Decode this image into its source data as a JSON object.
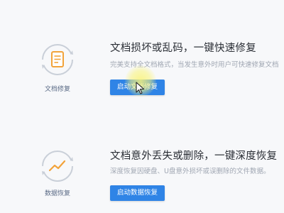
{
  "cards": [
    {
      "icon": "document-icon",
      "icon_label": "文档修复",
      "title": "文档损坏或乱码，一键快速修复",
      "description": "完美支持全文档格式，当发生意外时用户可快速修复文档",
      "button_label": "启动文档修复"
    },
    {
      "icon": "trend-line-icon",
      "icon_label": "数据恢复",
      "title": "文档意外丢失或删除，一键深度恢复",
      "description": "深度恢复因硬盘、U盘意外损坏或误删除的文件数据。",
      "button_label": "启动数据恢复"
    }
  ],
  "colors": {
    "accent": "#2f84e6",
    "icon_orange": "#f2a33a",
    "ring_gray": "#c9cfd8",
    "highlight": "#faf478"
  }
}
